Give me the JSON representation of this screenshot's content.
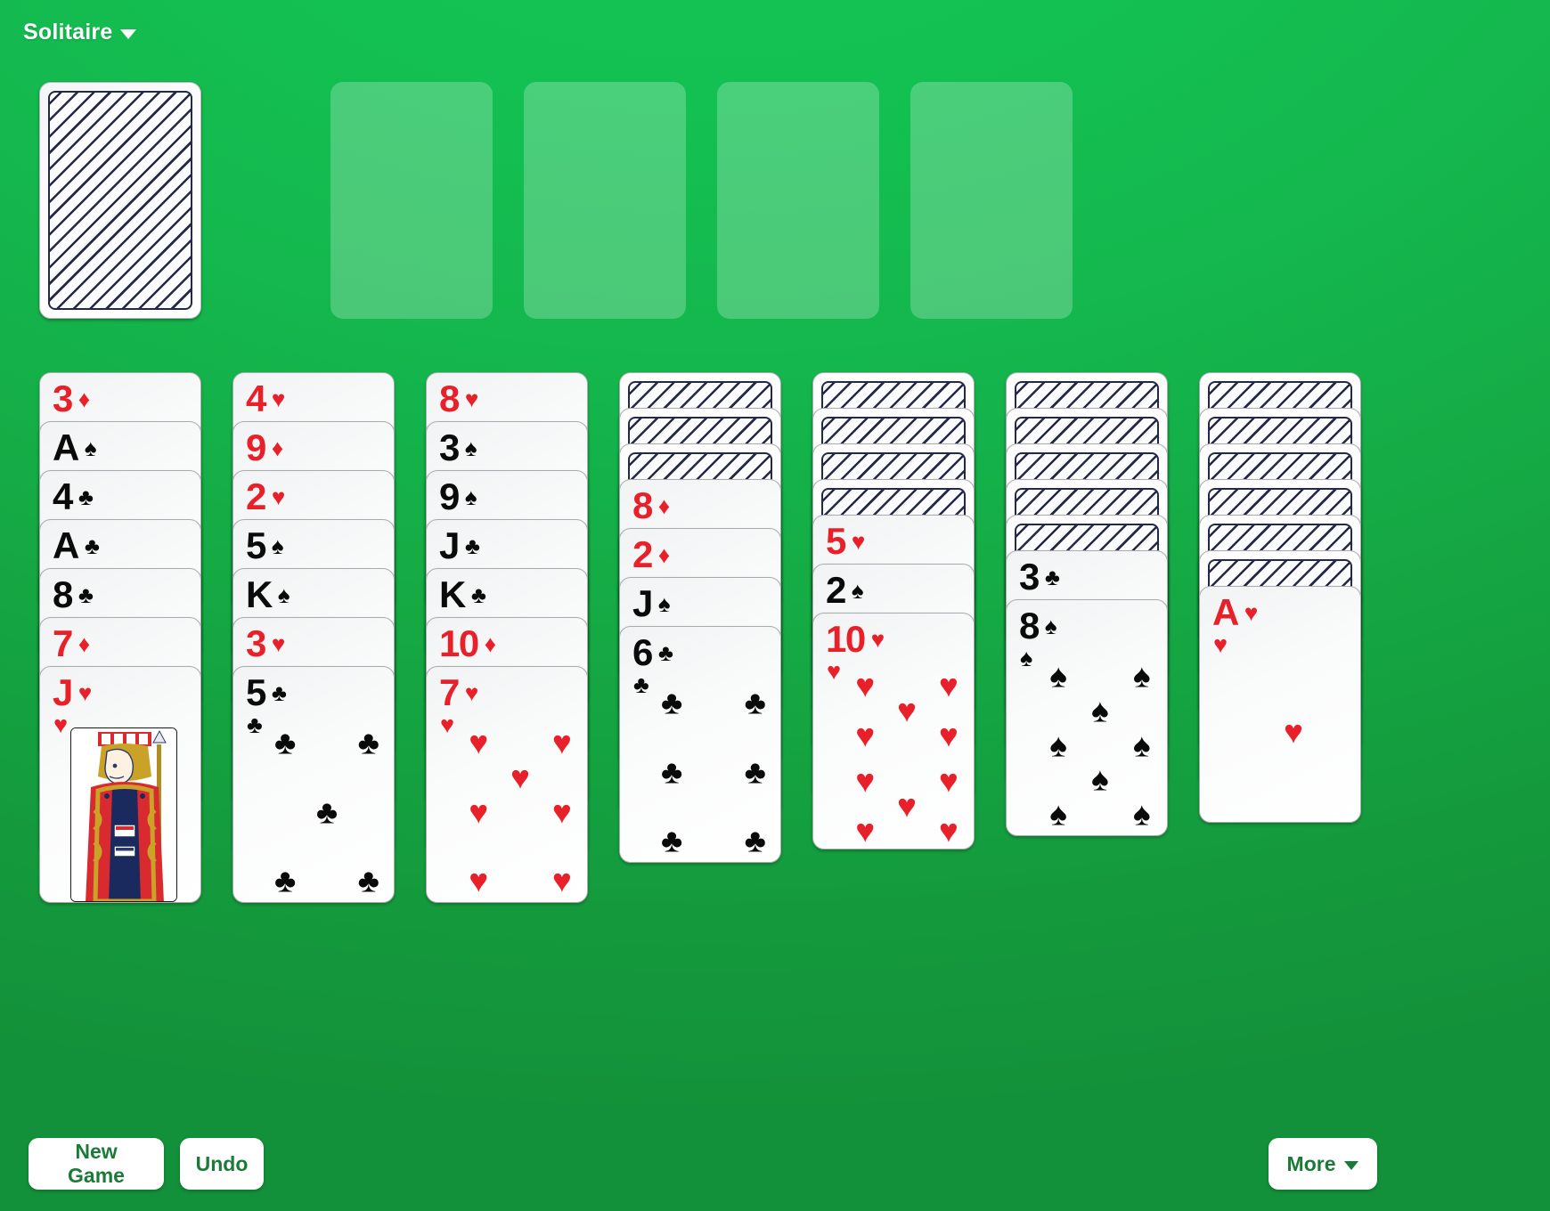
{
  "header": {
    "title": "Solitaire",
    "menu_caret_icon": "chevron-down-icon"
  },
  "colors": {
    "felt_top": "#12c752",
    "felt_bottom": "#13913a",
    "foundation_slot": "rgba(255,255,255,0.235)",
    "card_red": "#e8202a",
    "card_black": "#0a0a0a",
    "card_back_ink": "#232946",
    "button_text": "#1c7a38"
  },
  "stock": {
    "name": "stock-pile",
    "face_down": true,
    "count_visible": 1
  },
  "foundations": [
    {
      "index": 1,
      "suit": null,
      "empty": true
    },
    {
      "index": 2,
      "suit": null,
      "empty": true
    },
    {
      "index": 3,
      "suit": null,
      "empty": true
    },
    {
      "index": 4,
      "suit": null,
      "empty": true
    }
  ],
  "tableau": [
    {
      "column": 1,
      "face_down": 0,
      "cards": [
        {
          "rank": "3",
          "suit": "♦",
          "color": "red",
          "face_up": true
        },
        {
          "rank": "A",
          "suit": "♠",
          "color": "black",
          "face_up": true
        },
        {
          "rank": "4",
          "suit": "♣",
          "color": "black",
          "face_up": true
        },
        {
          "rank": "A",
          "suit": "♣",
          "color": "black",
          "face_up": true
        },
        {
          "rank": "8",
          "suit": "♣",
          "color": "black",
          "face_up": true
        },
        {
          "rank": "7",
          "suit": "♦",
          "color": "red",
          "face_up": true
        },
        {
          "rank": "J",
          "suit": "♥",
          "color": "red",
          "face_up": true
        }
      ]
    },
    {
      "column": 2,
      "face_down": 0,
      "cards": [
        {
          "rank": "4",
          "suit": "♥",
          "color": "red",
          "face_up": true
        },
        {
          "rank": "9",
          "suit": "♦",
          "color": "red",
          "face_up": true
        },
        {
          "rank": "2",
          "suit": "♥",
          "color": "red",
          "face_up": true
        },
        {
          "rank": "5",
          "suit": "♠",
          "color": "black",
          "face_up": true
        },
        {
          "rank": "K",
          "suit": "♠",
          "color": "black",
          "face_up": true
        },
        {
          "rank": "3",
          "suit": "♥",
          "color": "red",
          "face_up": true
        },
        {
          "rank": "5",
          "suit": "♣",
          "color": "black",
          "face_up": true
        }
      ]
    },
    {
      "column": 3,
      "face_down": 0,
      "cards": [
        {
          "rank": "8",
          "suit": "♥",
          "color": "red",
          "face_up": true
        },
        {
          "rank": "3",
          "suit": "♠",
          "color": "black",
          "face_up": true
        },
        {
          "rank": "9",
          "suit": "♠",
          "color": "black",
          "face_up": true
        },
        {
          "rank": "J",
          "suit": "♣",
          "color": "black",
          "face_up": true
        },
        {
          "rank": "K",
          "suit": "♣",
          "color": "black",
          "face_up": true
        },
        {
          "rank": "10",
          "suit": "♦",
          "color": "red",
          "face_up": true
        },
        {
          "rank": "7",
          "suit": "♥",
          "color": "red",
          "face_up": true
        }
      ]
    },
    {
      "column": 4,
      "face_down": 3,
      "cards": [
        {
          "rank": null,
          "suit": null,
          "color": null,
          "face_up": false
        },
        {
          "rank": null,
          "suit": null,
          "color": null,
          "face_up": false
        },
        {
          "rank": null,
          "suit": null,
          "color": null,
          "face_up": false
        },
        {
          "rank": "8",
          "suit": "♦",
          "color": "red",
          "face_up": true
        },
        {
          "rank": "2",
          "suit": "♦",
          "color": "red",
          "face_up": true
        },
        {
          "rank": "J",
          "suit": "♠",
          "color": "black",
          "face_up": true
        },
        {
          "rank": "6",
          "suit": "♣",
          "color": "black",
          "face_up": true
        }
      ]
    },
    {
      "column": 5,
      "face_down": 4,
      "cards": [
        {
          "rank": null,
          "suit": null,
          "color": null,
          "face_up": false
        },
        {
          "rank": null,
          "suit": null,
          "color": null,
          "face_up": false
        },
        {
          "rank": null,
          "suit": null,
          "color": null,
          "face_up": false
        },
        {
          "rank": null,
          "suit": null,
          "color": null,
          "face_up": false
        },
        {
          "rank": "5",
          "suit": "♥",
          "color": "red",
          "face_up": true
        },
        {
          "rank": "2",
          "suit": "♠",
          "color": "black",
          "face_up": true
        },
        {
          "rank": "10",
          "suit": "♥",
          "color": "red",
          "face_up": true
        }
      ]
    },
    {
      "column": 6,
      "face_down": 5,
      "cards": [
        {
          "rank": null,
          "suit": null,
          "color": null,
          "face_up": false
        },
        {
          "rank": null,
          "suit": null,
          "color": null,
          "face_up": false
        },
        {
          "rank": null,
          "suit": null,
          "color": null,
          "face_up": false
        },
        {
          "rank": null,
          "suit": null,
          "color": null,
          "face_up": false
        },
        {
          "rank": null,
          "suit": null,
          "color": null,
          "face_up": false
        },
        {
          "rank": "3",
          "suit": "♣",
          "color": "black",
          "face_up": true
        },
        {
          "rank": "8",
          "suit": "♠",
          "color": "black",
          "face_up": true
        }
      ]
    },
    {
      "column": 7,
      "face_down": 6,
      "cards": [
        {
          "rank": null,
          "suit": null,
          "color": null,
          "face_up": false
        },
        {
          "rank": null,
          "suit": null,
          "color": null,
          "face_up": false
        },
        {
          "rank": null,
          "suit": null,
          "color": null,
          "face_up": false
        },
        {
          "rank": null,
          "suit": null,
          "color": null,
          "face_up": false
        },
        {
          "rank": null,
          "suit": null,
          "color": null,
          "face_up": false
        },
        {
          "rank": null,
          "suit": null,
          "color": null,
          "face_up": false
        },
        {
          "rank": "A",
          "suit": "♥",
          "color": "red",
          "face_up": true
        }
      ]
    }
  ],
  "toolbar": {
    "new_game_label": "New Game",
    "undo_label": "Undo",
    "more_label": "More",
    "more_caret_icon": "chevron-down-icon"
  }
}
